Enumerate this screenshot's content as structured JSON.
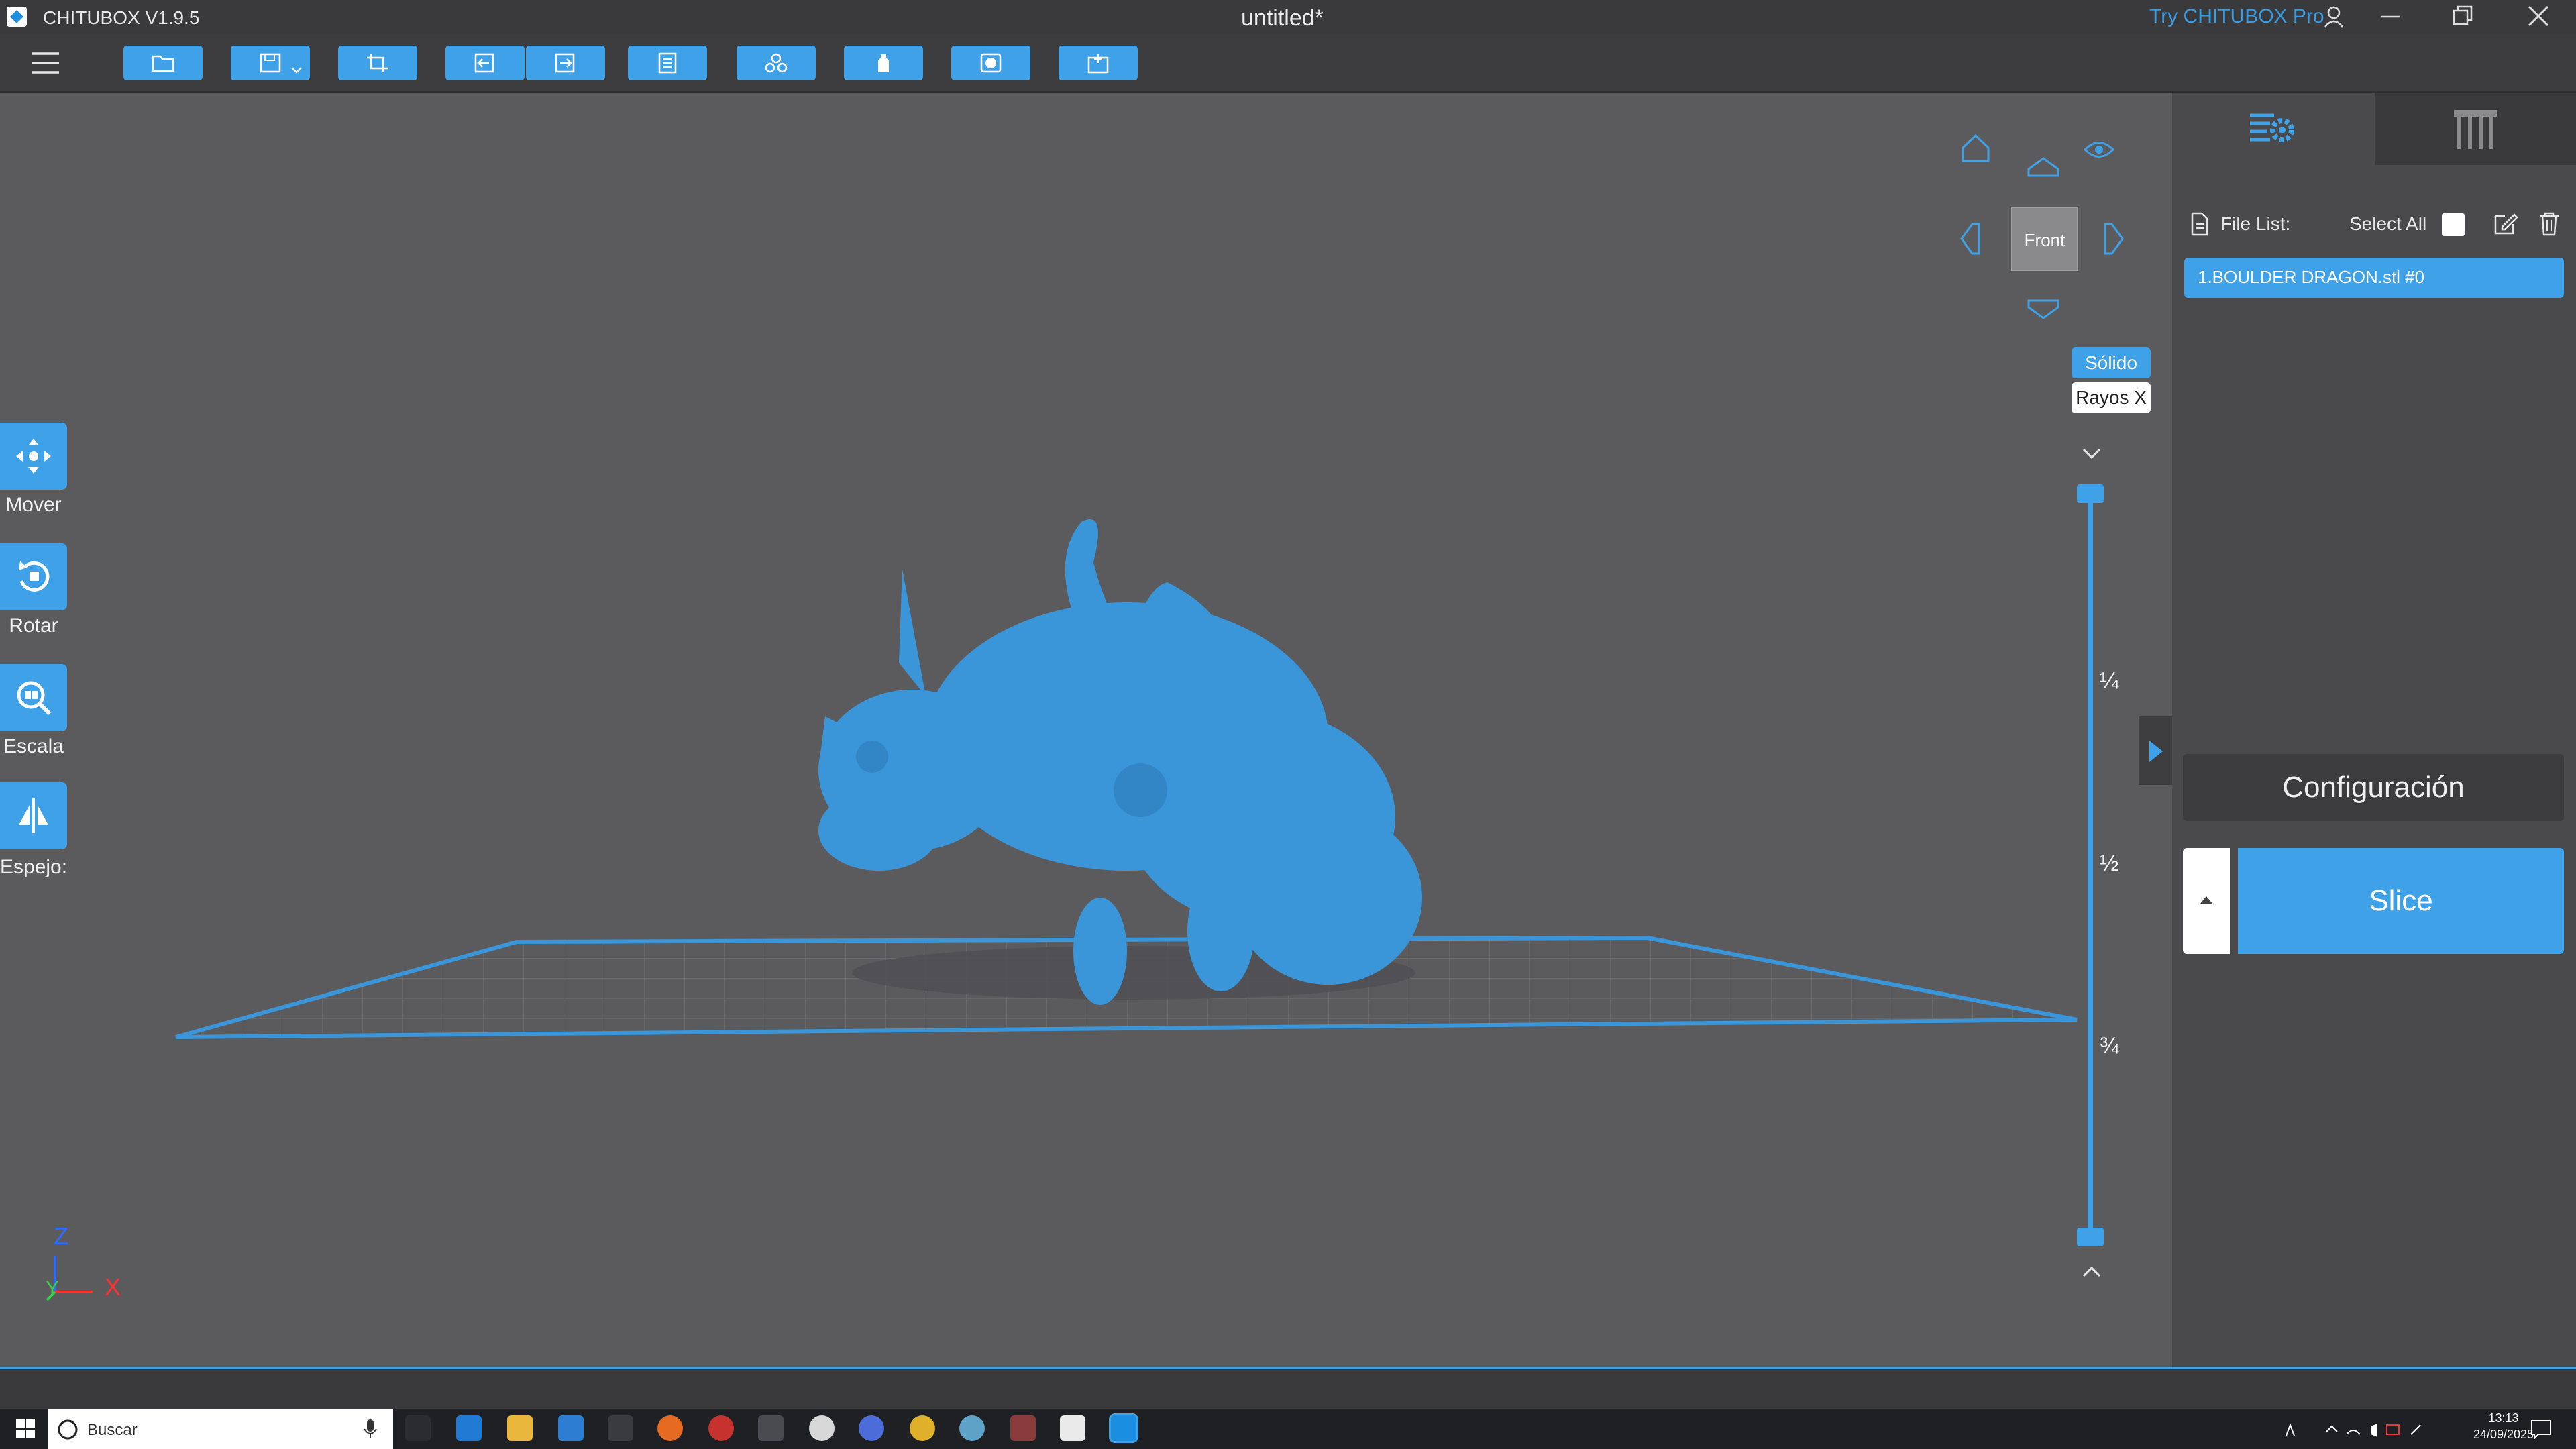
{
  "app": {
    "title": "CHITUBOX V1.9.5",
    "document_title": "untitled*",
    "try_pro": "Try CHITUBOX Pro"
  },
  "toolbar": {
    "buttons": [
      {
        "name": "open-file-button",
        "icon": "folder-icon"
      },
      {
        "name": "save-button",
        "icon": "save-icon"
      },
      {
        "name": "screenshot-button",
        "icon": "crop-icon"
      },
      {
        "name": "undo-button",
        "icon": "undo-icon"
      },
      {
        "name": "redo-button",
        "icon": "redo-icon"
      },
      {
        "name": "properties-button",
        "icon": "document-icon"
      },
      {
        "name": "arrange-button",
        "icon": "cluster-icon"
      },
      {
        "name": "supports-button",
        "icon": "support-icon"
      },
      {
        "name": "hollow-button",
        "icon": "hollow-icon"
      },
      {
        "name": "import-button",
        "icon": "box-icon"
      }
    ]
  },
  "tools": [
    {
      "label": "Mover",
      "icon": "move-icon"
    },
    {
      "label": "Rotar",
      "icon": "rotate-icon"
    },
    {
      "label": "Escala",
      "icon": "scale-icon"
    },
    {
      "label": "Espejo:",
      "icon": "mirror-icon"
    }
  ],
  "view": {
    "front": "Front",
    "solid": "Sólido",
    "xray": "Rayos X"
  },
  "layer_slider": {
    "ticks": [
      "¼",
      "½",
      "¾"
    ]
  },
  "axes": {
    "z": "Z",
    "y": "Y",
    "x": "X"
  },
  "panel": {
    "file_list_label": "File List:",
    "select_all_label": "Select All",
    "files": [
      "1.BOULDER DRAGON.stl #0"
    ],
    "config_label": "Configuración",
    "slice_label": "Slice"
  },
  "taskbar": {
    "search_placeholder": "Buscar",
    "time": "13:13",
    "date": "24/09/2025"
  },
  "colors": {
    "accent": "#3fa2e8",
    "model": "#3a96d8",
    "background": "#5b5b5e"
  }
}
